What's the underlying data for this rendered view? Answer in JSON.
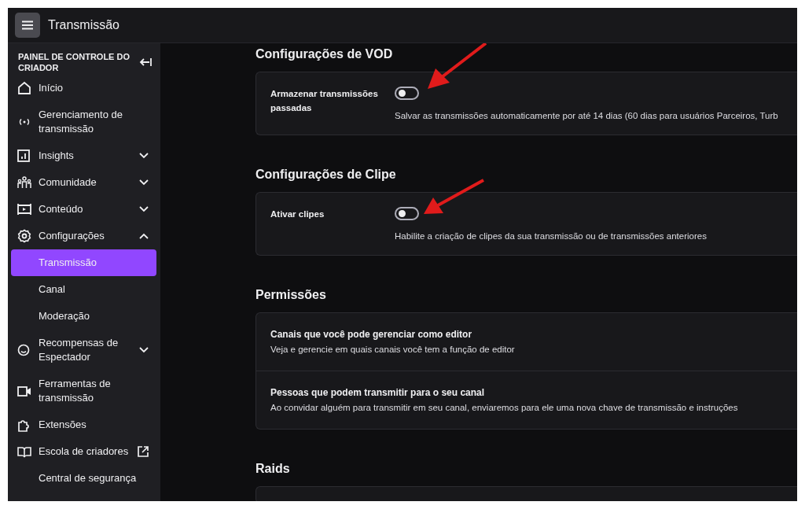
{
  "app_bar": {
    "title": "Transmissão"
  },
  "sidebar": {
    "heading": "PAINEL DE CONTROLE DO CRIADOR",
    "items": [
      {
        "label": "Início",
        "kind": "home"
      },
      {
        "label": "Gerenciamento de transmissão",
        "kind": "broadcast"
      },
      {
        "label": "Insights",
        "kind": "chart",
        "expanded": false
      },
      {
        "label": "Comunidade",
        "kind": "people",
        "expanded": false
      },
      {
        "label": "Conteúdo",
        "kind": "film",
        "expanded": false
      },
      {
        "label": "Configurações",
        "kind": "gear",
        "expanded": true,
        "children": [
          {
            "label": "Transmissão",
            "selected": true
          },
          {
            "label": "Canal",
            "selected": false
          },
          {
            "label": "Moderação",
            "selected": false
          }
        ]
      },
      {
        "label": "Recompensas de Espectador",
        "kind": "smile",
        "expanded": false
      },
      {
        "label": "Ferramentas de transmissão",
        "kind": "camera"
      },
      {
        "label": "Extensões",
        "kind": "puzzle"
      },
      {
        "label": "Escola de criadores",
        "kind": "book",
        "external": true
      },
      {
        "label": "Central de segurança",
        "kind": "plain"
      }
    ]
  },
  "sections": [
    {
      "title": "Configurações de VOD",
      "rows": [
        {
          "kind": "toggle",
          "label": "Armazenar transmissões passadas",
          "on": false,
          "description": "Salvar as transmissões automaticamente por até 14 dias (60 dias para usuários Parceiros, Turb"
        }
      ]
    },
    {
      "title": "Configurações de Clipe",
      "rows": [
        {
          "kind": "toggle",
          "label": "Ativar clipes",
          "on": false,
          "description": "Habilite a criação de clipes da sua transmissão ou de transmissões anteriores"
        }
      ]
    },
    {
      "title": "Permissões",
      "rows": [
        {
          "kind": "link",
          "label": "Canais que você pode gerenciar como editor",
          "description": "Veja e gerencie em quais canais você tem a função de editor"
        },
        {
          "kind": "link",
          "label": "Pessoas que podem transmitir para o seu canal",
          "description": "Ao convidar alguém para transmitir em seu canal, enviaremos para ele uma nova chave de transmissão e instruções"
        }
      ]
    },
    {
      "title": "Raids"
    }
  ]
}
